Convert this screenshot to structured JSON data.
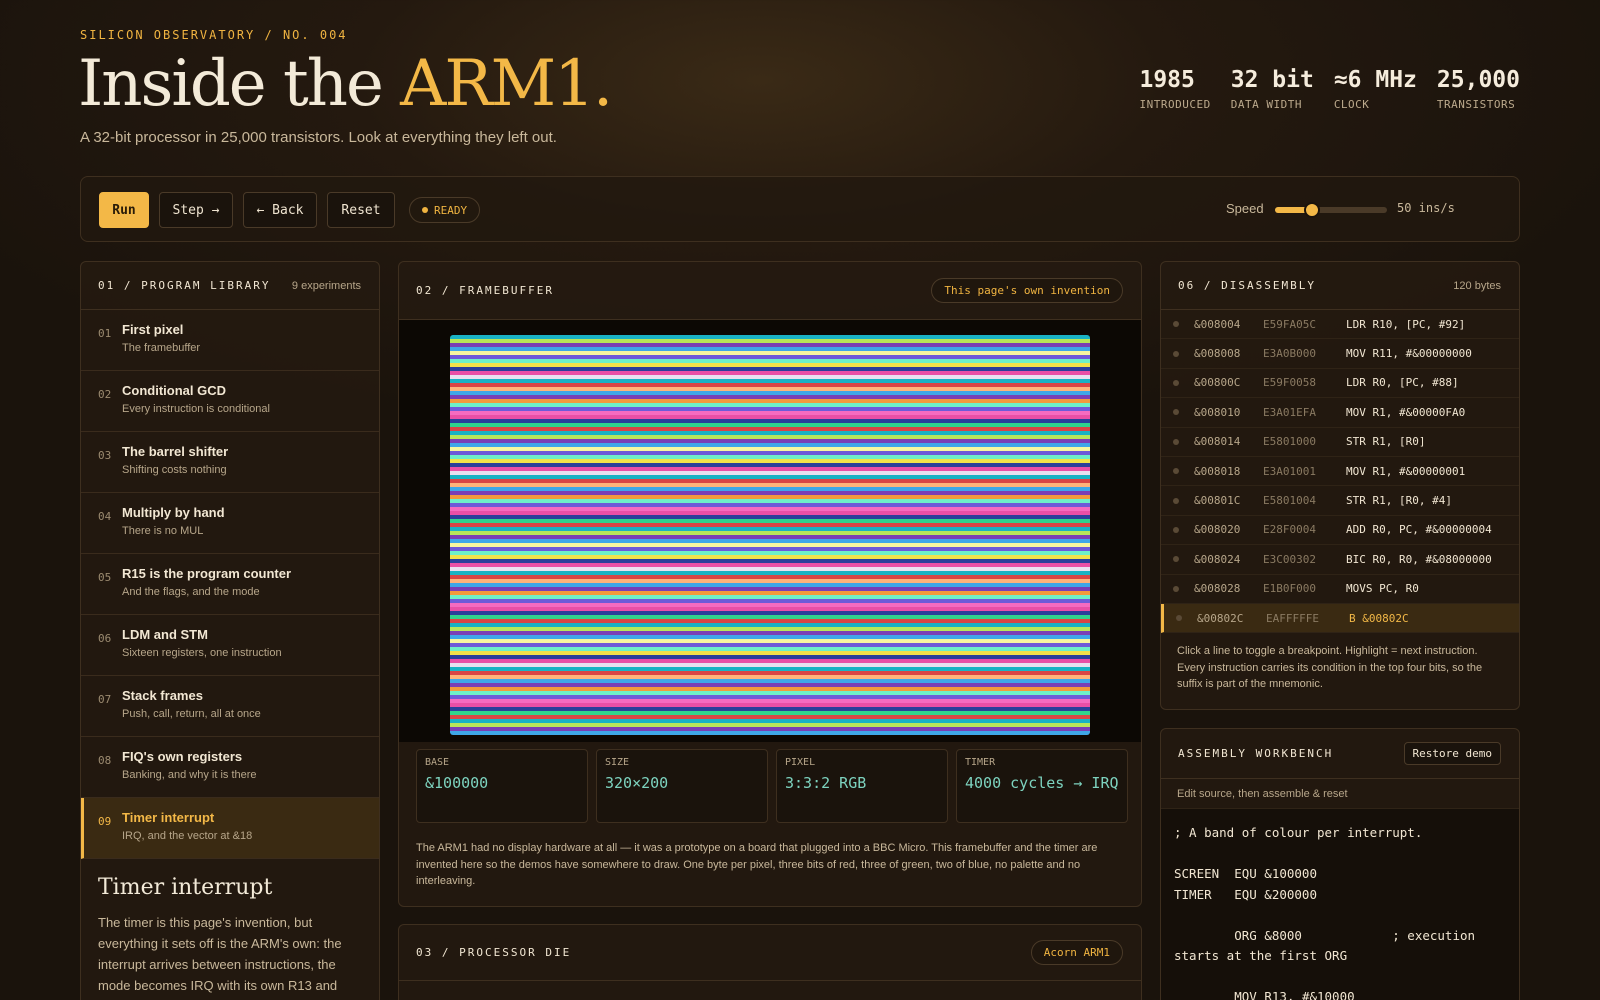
{
  "header": {
    "eyebrow": "SILICON OBSERVATORY / NO. 004",
    "title_main": "Inside the ",
    "title_accent": "ARM1.",
    "subtitle": "A 32-bit processor in 25,000 transistors. Look at everything they left out.",
    "stats": [
      {
        "value": "1985",
        "label": "INTRODUCED"
      },
      {
        "value": "32 bit",
        "label": "DATA WIDTH"
      },
      {
        "value": "≈6 MHz",
        "label": "CLOCK"
      },
      {
        "value": "25,000",
        "label": "TRANSISTORS"
      }
    ]
  },
  "toolbar": {
    "run": "Run",
    "step": "Step →",
    "back": "← Back",
    "reset": "Reset",
    "status": "READY",
    "speed_label": "Speed",
    "speed_value": "50 ins/s",
    "speed_fraction": 0.33
  },
  "library": {
    "title": "01 / PROGRAM LIBRARY",
    "meta": "9 experiments",
    "items": [
      {
        "num": "01",
        "title": "First pixel",
        "subtitle": "The framebuffer"
      },
      {
        "num": "02",
        "title": "Conditional GCD",
        "subtitle": "Every instruction is conditional"
      },
      {
        "num": "03",
        "title": "The barrel shifter",
        "subtitle": "Shifting costs nothing"
      },
      {
        "num": "04",
        "title": "Multiply by hand",
        "subtitle": "There is no MUL"
      },
      {
        "num": "05",
        "title": "R15 is the program counter",
        "subtitle": "And the flags, and the mode"
      },
      {
        "num": "06",
        "title": "LDM and STM",
        "subtitle": "Sixteen registers, one instruction"
      },
      {
        "num": "07",
        "title": "Stack frames",
        "subtitle": "Push, call, return, all at once"
      },
      {
        "num": "08",
        "title": "FIQ's own registers",
        "subtitle": "Banking, and why it is there"
      },
      {
        "num": "09",
        "title": "Timer interrupt",
        "subtitle": "IRQ, and the vector at &18"
      }
    ],
    "lesson_title": "Timer interrupt",
    "lesson_body": "The timer is this page's invention, but everything it sets off is the ARM's own: the interrupt arrives between instructions, the mode becomes IRQ with its own R13 and"
  },
  "framebuffer": {
    "title": "02 / FRAMEBUFFER",
    "badge": "This page's own invention",
    "stats": [
      {
        "label": "BASE",
        "value": "&100000"
      },
      {
        "label": "SIZE",
        "value": "320×200"
      },
      {
        "label": "PIXEL",
        "value": "3:3:2 RGB"
      },
      {
        "label": "TIMER",
        "value": "4000 cycles → IRQ"
      }
    ],
    "note": "The ARM1 had no display hardware at all — it was a prototype on a board that plugged into a BBC Micro. This framebuffer and the timer are invented here so the demos have somewhere to draw. One byte per pixel, three bits of red, three of green, two of blue, no palette and no interleaving.",
    "palette": [
      "#19b2c4",
      "#2fd38d",
      "#e94fa6",
      "#f2e24a",
      "#6e5ad8",
      "#f29a3c",
      "#3fa7e8",
      "#b8e65a",
      "#d94545",
      "#e8e0f0",
      "#2a3f9a",
      "#f56bc0",
      "#6ef0c8",
      "#f7f7a0",
      "#7a3fb5",
      "#ffb37a"
    ]
  },
  "die": {
    "title": "03 / PROCESSOR DIE",
    "badge": "Acorn ARM1"
  },
  "disassembly": {
    "title": "06 / DISASSEMBLY",
    "meta": "120 bytes",
    "rows": [
      {
        "addr": "&008004",
        "hex": "E59FA05C",
        "ins": "LDR R10, [PC, #92]"
      },
      {
        "addr": "&008008",
        "hex": "E3A0B000",
        "ins": "MOV R11, #&00000000"
      },
      {
        "addr": "&00800C",
        "hex": "E59F0058",
        "ins": "LDR R0, [PC, #88]"
      },
      {
        "addr": "&008010",
        "hex": "E3A01EFA",
        "ins": "MOV R1, #&00000FA0"
      },
      {
        "addr": "&008014",
        "hex": "E5801000",
        "ins": "STR R1, [R0]"
      },
      {
        "addr": "&008018",
        "hex": "E3A01001",
        "ins": "MOV R1, #&00000001"
      },
      {
        "addr": "&00801C",
        "hex": "E5801004",
        "ins": "STR R1, [R0, #4]"
      },
      {
        "addr": "&008020",
        "hex": "E28F0004",
        "ins": "ADD R0, PC, #&00000004"
      },
      {
        "addr": "&008024",
        "hex": "E3C00302",
        "ins": "BIC R0, R0, #&08000000"
      },
      {
        "addr": "&008028",
        "hex": "E1B0F000",
        "ins": "MOVS PC, R0"
      },
      {
        "addr": "&00802C",
        "hex": "EAFFFFFE",
        "ins": "B &00802C"
      }
    ],
    "current_index": 10,
    "note": "Click a line to toggle a breakpoint. Highlight = next instruction. Every instruction carries its condition in the top four bits, so the suffix is part of the mnemonic."
  },
  "workbench": {
    "title": "ASSEMBLY WORKBENCH",
    "restore": "Restore demo",
    "hint": "Edit source, then assemble & reset",
    "code": "; A band of colour per interrupt.\n\nSCREEN  EQU &100000\nTIMER   EQU &200000\n\n        ORG &8000            ; execution starts at the first ORG\n\n        MOV R13, #&10000"
  }
}
